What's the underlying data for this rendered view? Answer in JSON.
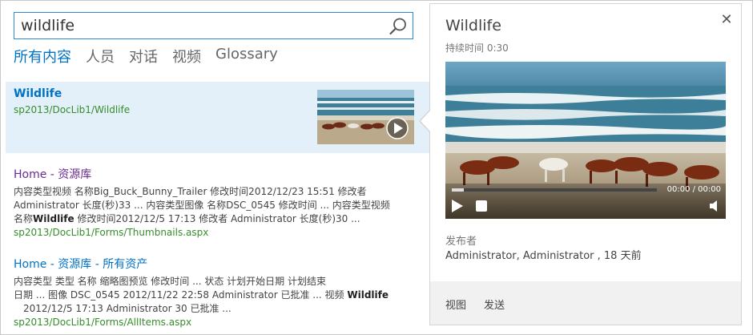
{
  "search": {
    "query": "wildlife"
  },
  "verticals": [
    "所有内容",
    "人员",
    "对话",
    "视频",
    "Glossary"
  ],
  "results": [
    {
      "title": "Wildlife",
      "url": "sp2013/DocLib1/Wildlife"
    },
    {
      "title": "Home - 资源库",
      "lines": [
        "内容类型视频 名称Big_Buck_Bunny_Trailer 修改时间2012/12/23 15:51 修改者",
        "Administrator 长度(秒)33 ... 内容类型图像 名称DSC_0545 修改时间 ... 内容类型视频",
        {
          "pre": "名称",
          "bold": "Wildlife",
          "post": " 修改时间2012/12/5 17:13 修改者 Administrator 长度(秒)30 ..."
        }
      ],
      "url": "sp2013/DocLib1/Forms/Thumbnails.aspx"
    },
    {
      "title": "Home - 资源库 - 所有资产",
      "lines": [
        "内容类型    类型    名称    缩略图预览    修改时间 ... 状态    计划开始日期    计划结束",
        "日期 ... 图像 DSC_0545    2012/11/22 22:58 Administrator 已批准 ... 视频 ",
        "2012/12/5 17:13 Administrator 30 已批准 ..."
      ],
      "line2_bold": "Wildlife",
      "url": "sp2013/DocLib1/Forms/AllItems.aspx"
    }
  ],
  "hover_panel": {
    "title": "Wildlife",
    "duration": "持续时间 0:30",
    "video_time": "00:00 / 00:00",
    "video_progress": 0.06,
    "publisher_label": "发布者",
    "publisher_value": "Administrator, Administrator , 18 天前",
    "actions": [
      "视图",
      "发送"
    ]
  },
  "colors": {
    "accent": "#0072c6",
    "url_green": "#358d2a",
    "visited": "#6b2c91",
    "selected_bg": "#e3eff9"
  }
}
